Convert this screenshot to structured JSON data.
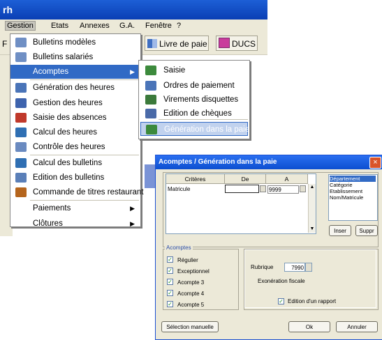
{
  "window": {
    "title": "rh"
  },
  "menubar": {
    "items": [
      "Gestion",
      "Etats",
      "Annexes",
      "G.A.",
      "Fenêtre",
      "?"
    ]
  },
  "toolbar": {
    "partial_left": "F",
    "livre_label": "Livre de paie",
    "ducs_label": "DUCS"
  },
  "gestion_menu": {
    "items": [
      {
        "label": "Bulletins modèles",
        "icon": "document-icon"
      },
      {
        "label": "Bulletins salariés",
        "icon": "document-icon"
      },
      {
        "label": "Acomptes",
        "icon": "",
        "submenu": true,
        "selected": true
      },
      {
        "label": "Génération des heures",
        "icon": "calendar-icon"
      },
      {
        "label": "Gestion des heures",
        "icon": "clock-icon"
      },
      {
        "label": "Saisie des absences",
        "icon": "absence-icon"
      },
      {
        "label": "Calcul des heures",
        "icon": "calc-icon"
      },
      {
        "label": "Contrôle des heures",
        "icon": "check-icon"
      },
      {
        "label": "Calcul des bulletins",
        "icon": "calc-icon"
      },
      {
        "label": "Edition des bulletins",
        "icon": "print-icon"
      },
      {
        "label": "Commande de titres restaurant",
        "icon": "ticket-icon"
      },
      {
        "label": "Paiements",
        "icon": "",
        "submenu": true
      },
      {
        "label": "Clôtures",
        "icon": "",
        "submenu": true
      }
    ]
  },
  "acomptes_submenu": {
    "items": [
      {
        "label": "Saisie",
        "icon": "edit-icon"
      },
      {
        "label": "Ordres de paiement",
        "icon": "order-icon"
      },
      {
        "label": "Virements disquettes",
        "icon": "disk-icon"
      },
      {
        "label": "Edition de chèques",
        "icon": "check-print-icon"
      },
      {
        "label": "Génération dans la paie",
        "icon": "generate-icon",
        "selected": true
      }
    ]
  },
  "dialog": {
    "title": "Acomptes / Génération dans la paie",
    "close": "×",
    "criteria": {
      "headers": [
        "Critères",
        "De",
        "A"
      ],
      "row": {
        "critere": "Matricule",
        "de": "",
        "a": "9999"
      }
    },
    "criteria_list": [
      "Département",
      "Catégorie",
      "Etablissement",
      "Nom/Matricule"
    ],
    "insert_button": "Inser",
    "delete_button": "Suppr",
    "acomptes_group": {
      "legend": "Acomptes",
      "items": [
        {
          "label": "Régulier",
          "checked": true
        },
        {
          "label": "Exceptionnel",
          "checked": true
        },
        {
          "label": "Acompte 3",
          "checked": true
        },
        {
          "label": "Acompte 4",
          "checked": true
        },
        {
          "label": "Acompte 5",
          "checked": true
        }
      ]
    },
    "rubrique_label": "Rubrique",
    "rubrique_value": "7990",
    "exoneration_label": "Exonération fiscale",
    "edition_rapport_label": "Edition d'un rapport",
    "edition_rapport_checked": true,
    "selection_button": "Sélection manuelle",
    "ok_button": "Ok",
    "cancel_button": "Annuler"
  },
  "colors": {
    "accent": "#316ac5",
    "titlebar": "#0a3fb4",
    "dialog_bg": "#ece9d8"
  }
}
